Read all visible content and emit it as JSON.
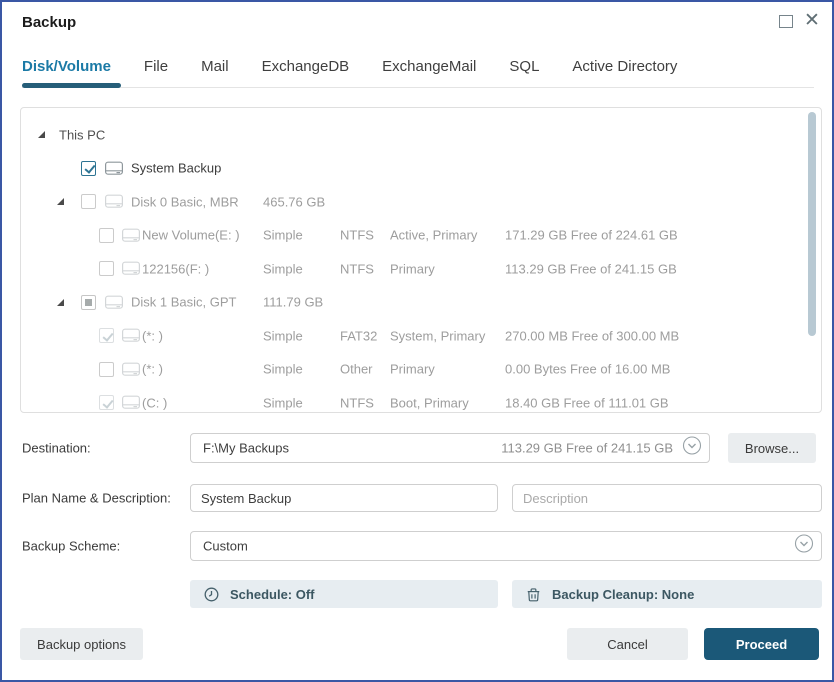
{
  "window": {
    "title": "Backup"
  },
  "icons": {
    "close_glyph": "✕",
    "maximize": "square-outline",
    "combo_chevron": "chevron-down-in-circle",
    "schedule": "clock",
    "cleanup": "trash-bin",
    "tree_expander": "triangle-expanded",
    "volume": "hard-drive"
  },
  "colors": {
    "accent": "#1b7aa6",
    "accent_dark": "#265e79",
    "proceed_bg": "#1b5878",
    "window_border": "#3a57a5",
    "scrollbar": "#b8c9d3",
    "checked_teal": "#2d7493"
  },
  "tabs": [
    {
      "label": "Disk/Volume",
      "active": true
    },
    {
      "label": "File",
      "active": false
    },
    {
      "label": "Mail",
      "active": false
    },
    {
      "label": "ExchangeDB",
      "active": false
    },
    {
      "label": "ExchangeMail",
      "active": false
    },
    {
      "label": "SQL",
      "active": false
    },
    {
      "label": "Active Directory",
      "active": false
    }
  ],
  "tree": {
    "rows": [
      {
        "level": 0,
        "expander": true,
        "checkbox": "none",
        "icon": false,
        "name": "This PC"
      },
      {
        "level": 1,
        "expander": false,
        "checkbox": "checked",
        "icon": true,
        "strong": true,
        "name": "System Backup"
      },
      {
        "level": 1,
        "expander": true,
        "checkbox": "unchecked",
        "icon": true,
        "name": "Disk 0 Basic, MBR",
        "type": "465.76 GB"
      },
      {
        "level": 2,
        "expander": false,
        "checkbox": "unchecked",
        "icon": true,
        "name": "New Volume(E: )",
        "type": "Simple",
        "fs": "NTFS",
        "attr": "Active, Primary",
        "size": "171.29 GB Free of 224.61 GB"
      },
      {
        "level": 2,
        "expander": false,
        "checkbox": "unchecked",
        "icon": true,
        "name": "122156(F: )",
        "type": "Simple",
        "fs": "NTFS",
        "attr": "Primary",
        "size": "113.29 GB Free of 241.15 GB"
      },
      {
        "level": 1,
        "expander": true,
        "checkbox": "partial",
        "icon": true,
        "name": "Disk 1 Basic, GPT",
        "type": "111.79 GB"
      },
      {
        "level": 2,
        "expander": false,
        "checkbox": "checked-disabled",
        "icon": true,
        "name": "(*: )",
        "type": "Simple",
        "fs": "FAT32",
        "attr": "System, Primary",
        "size": "270.00 MB Free of 300.00 MB"
      },
      {
        "level": 2,
        "expander": false,
        "checkbox": "unchecked",
        "icon": true,
        "name": "(*: )",
        "type": "Simple",
        "fs": "Other",
        "attr": "Primary",
        "size": "0.00 Bytes Free of 16.00 MB"
      },
      {
        "level": 2,
        "expander": false,
        "checkbox": "checked-disabled",
        "icon": true,
        "name": "(C: )",
        "type": "Simple",
        "fs": "NTFS",
        "attr": "Boot, Primary",
        "size": "18.40 GB Free of 111.01 GB"
      }
    ]
  },
  "form": {
    "destination_label": "Destination:",
    "destination_value": "F:\\My Backups",
    "destination_free": "113.29 GB Free of 241.15 GB",
    "browse_label": "Browse...",
    "plan_label": "Plan Name & Description:",
    "plan_name_value": "System Backup",
    "description_placeholder": "Description",
    "scheme_label": "Backup Scheme:",
    "scheme_value": "Custom",
    "schedule_label": "Schedule: Off",
    "cleanup_label": "Backup Cleanup: None"
  },
  "footer": {
    "backup_options_label": "Backup options",
    "cancel_label": "Cancel",
    "proceed_label": "Proceed"
  }
}
